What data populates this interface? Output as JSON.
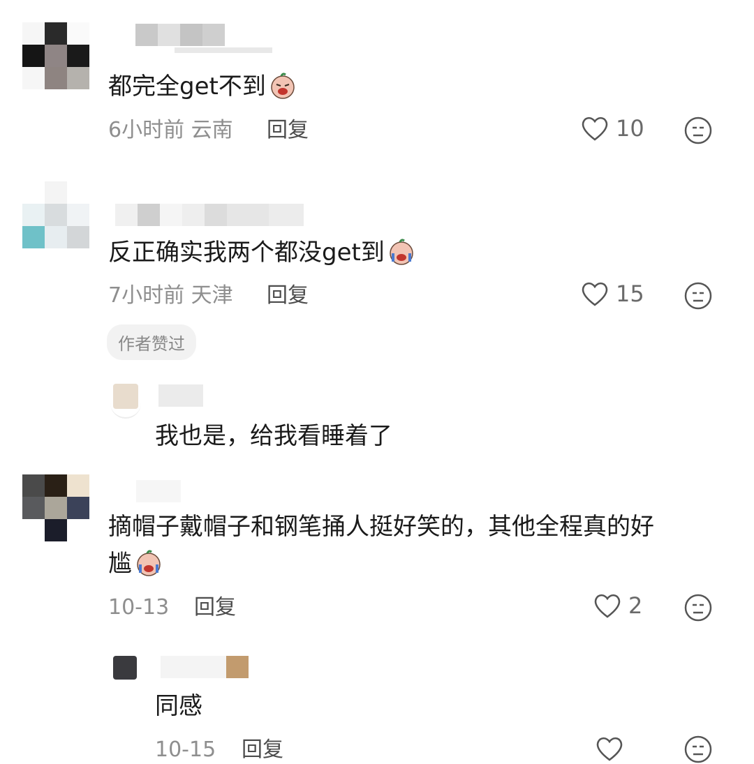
{
  "comments": [
    {
      "text": "都完全get不到",
      "time": "6小时前",
      "location": "云南",
      "reply_label": "回复",
      "likes": "10",
      "emoji": "crying-face-icon"
    },
    {
      "text": "反正确实我两个都没get到",
      "time": "7小时前",
      "location": "天津",
      "reply_label": "回复",
      "likes": "15",
      "badge": "作者赞过",
      "emoji": "crying-face-icon",
      "reply": {
        "text": "我也是，给我看睡着了"
      }
    },
    {
      "text_line1": "摘帽子戴帽子和钢笔捅人挺好笑的，其他全程真的好",
      "text_line2": "尴",
      "time": "10-13",
      "reply_label": "回复",
      "likes": "2",
      "emoji": "crying-face-icon",
      "reply": {
        "text": "同感",
        "time": "10-15",
        "reply_label": "回复"
      }
    }
  ],
  "colors": {
    "meta_gray": "#8e8e8e",
    "text": "#1a1a1a",
    "badge_bg": "#f2f2f2"
  }
}
